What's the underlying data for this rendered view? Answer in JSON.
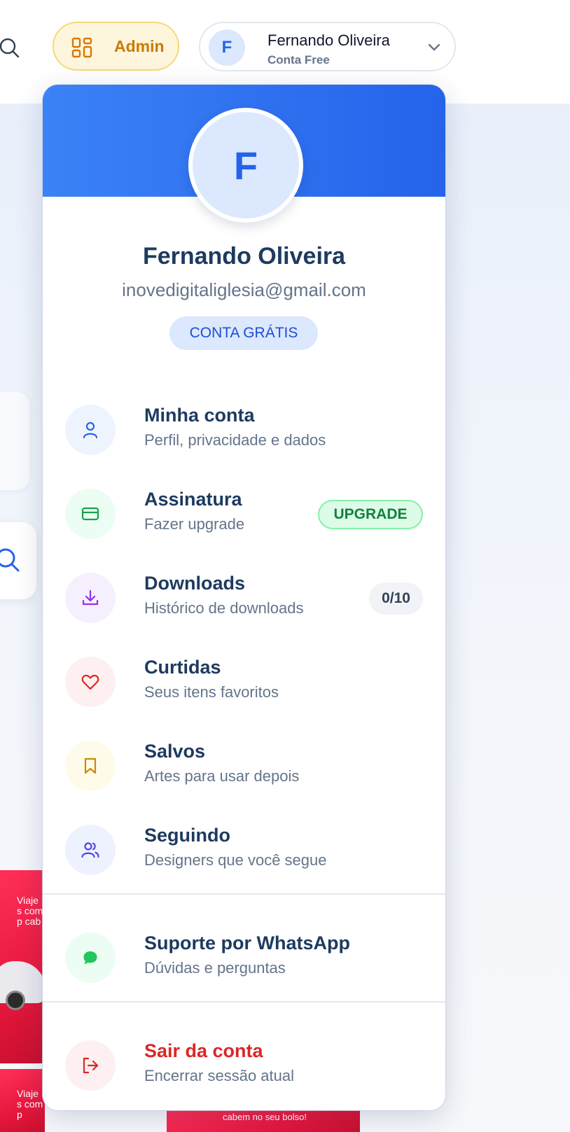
{
  "header": {
    "admin_label": "Admin",
    "user_name": "Fernando Oliveira",
    "user_plan": "Conta Free",
    "avatar_initial": "F"
  },
  "profile": {
    "avatar_initial": "F",
    "name": "Fernando Oliveira",
    "email": "inovedigitaliglesia@gmail.com",
    "badge": "CONTA GRÁTIS"
  },
  "menu": {
    "items": [
      {
        "title": "Minha conta",
        "subtitle": "Perfil, privacidade e dados",
        "icon": "user-icon"
      },
      {
        "title": "Assinatura",
        "subtitle": "Fazer upgrade",
        "icon": "credit-card-icon",
        "pill": "UPGRADE"
      },
      {
        "title": "Downloads",
        "subtitle": "Histórico de downloads",
        "icon": "download-icon",
        "pill": "0/10"
      },
      {
        "title": "Curtidas",
        "subtitle": "Seus itens favoritos",
        "icon": "heart-icon"
      },
      {
        "title": "Salvos",
        "subtitle": "Artes para usar depois",
        "icon": "bookmark-icon"
      },
      {
        "title": "Seguindo",
        "subtitle": "Designers que você segue",
        "icon": "users-icon"
      }
    ],
    "support": {
      "title": "Suporte por WhatsApp",
      "subtitle": "Dúvidas e perguntas",
      "icon": "chat-bubble-icon"
    },
    "logout": {
      "title": "Sair da conta",
      "subtitle": "Encerrar sessão atual",
      "icon": "logout-icon"
    }
  },
  "background": {
    "thumb_text_1": "Viaje s com p cab",
    "thumb_text_2": "Viaje s com p",
    "thumb_text_3": "cabem no seu bolso!"
  },
  "colors": {
    "brand_blue": "#2563eb",
    "admin_gold": "#c97a08",
    "logout_red": "#dc2626",
    "upgrade_green": "#15803d"
  }
}
